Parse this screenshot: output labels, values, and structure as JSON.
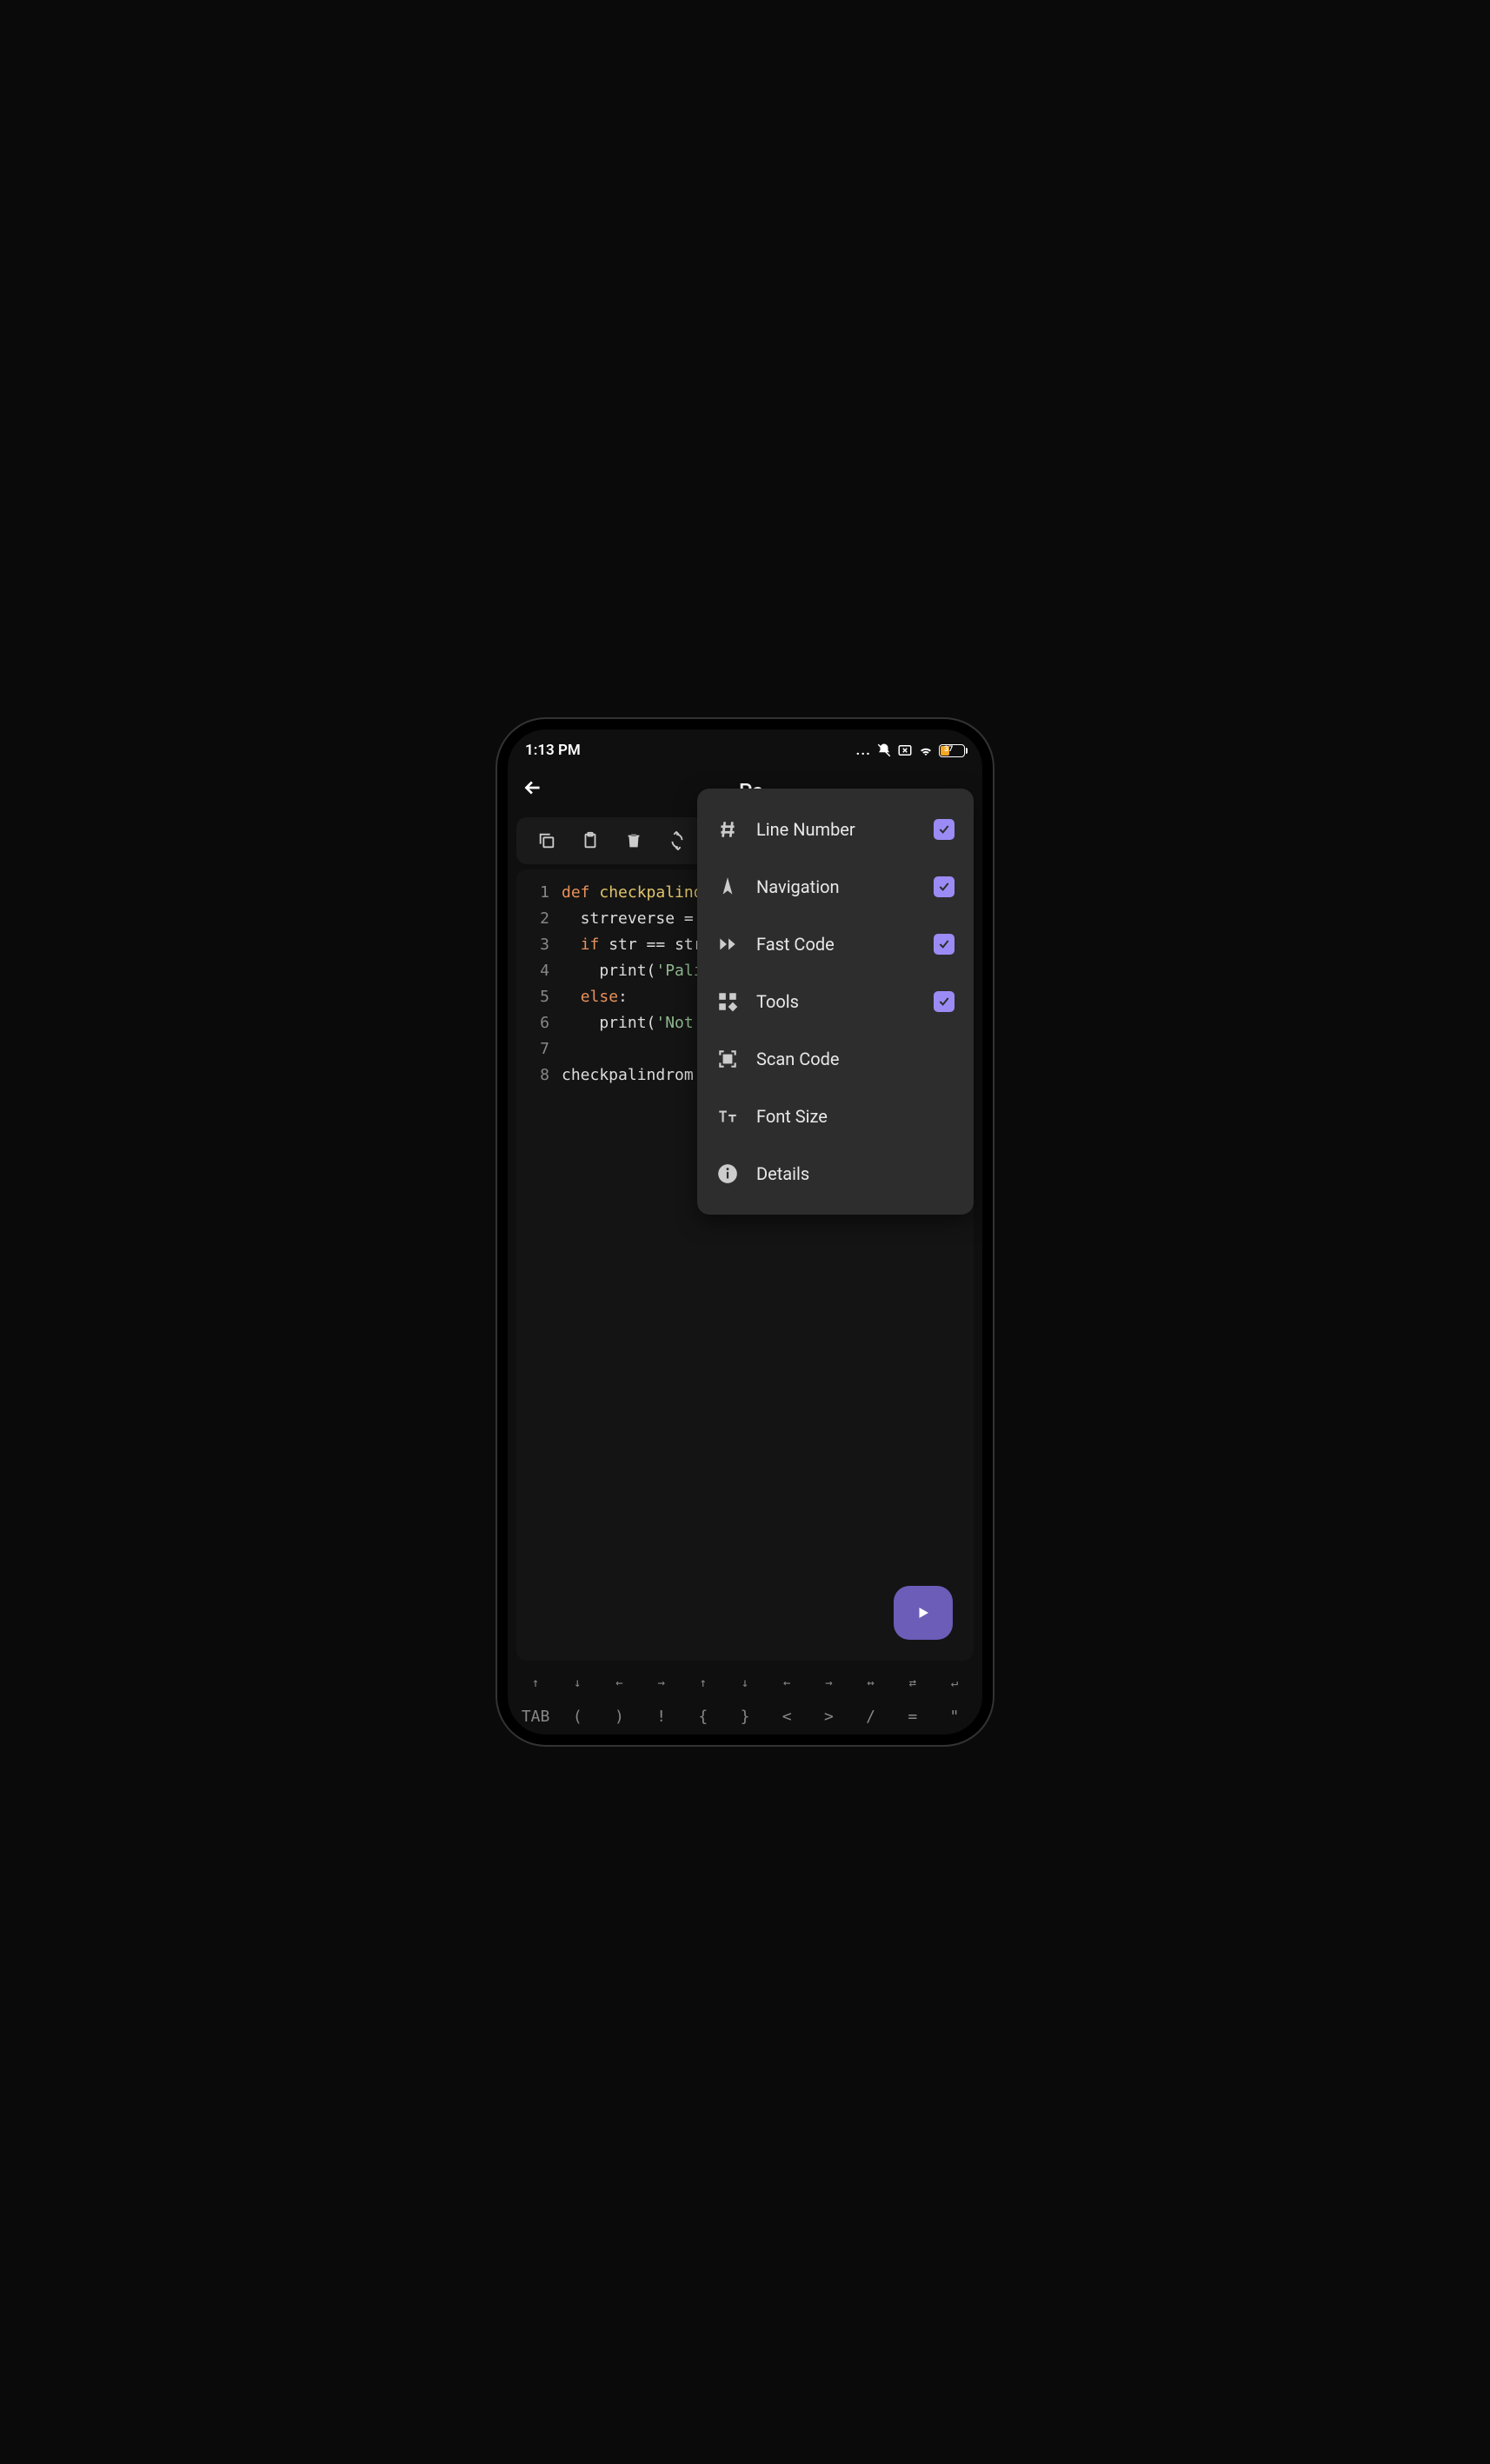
{
  "status": {
    "time": "1:13 PM",
    "battery_pct": "37"
  },
  "header": {
    "title": "Pa"
  },
  "code": {
    "lines": [
      {
        "num": "1",
        "tokens": [
          {
            "t": "def ",
            "c": "kw-def"
          },
          {
            "t": "checkpalind",
            "c": "fn-name"
          }
        ]
      },
      {
        "num": "2",
        "tokens": [
          {
            "t": "  strreverse = st",
            "c": "punct"
          }
        ]
      },
      {
        "num": "3",
        "tokens": [
          {
            "t": "  ",
            "c": "punct"
          },
          {
            "t": "if",
            "c": "kw-if"
          },
          {
            "t": " str == strreve",
            "c": "punct"
          }
        ]
      },
      {
        "num": "4",
        "tokens": [
          {
            "t": "    print(",
            "c": "punct"
          },
          {
            "t": "'Palindro",
            "c": "str"
          }
        ]
      },
      {
        "num": "5",
        "tokens": [
          {
            "t": "  ",
            "c": "punct"
          },
          {
            "t": "else",
            "c": "kw-else"
          },
          {
            "t": ":",
            "c": "punct"
          }
        ]
      },
      {
        "num": "6",
        "tokens": [
          {
            "t": "    print(",
            "c": "punct"
          },
          {
            "t": "'Not a pa",
            "c": "str"
          }
        ]
      },
      {
        "num": "7",
        "tokens": []
      },
      {
        "num": "8",
        "tokens": [
          {
            "t": "checkpalindrom",
            "c": "punct"
          }
        ]
      }
    ]
  },
  "popup": {
    "items": [
      {
        "icon": "hash",
        "label": "Line Number",
        "checked": true
      },
      {
        "icon": "nav",
        "label": "Navigation",
        "checked": true
      },
      {
        "icon": "fast",
        "label": "Fast Code",
        "checked": true
      },
      {
        "icon": "tools",
        "label": "Tools",
        "checked": true
      },
      {
        "icon": "scan",
        "label": "Scan Code",
        "checked": false
      },
      {
        "icon": "font",
        "label": "Font Size",
        "checked": false
      },
      {
        "icon": "info",
        "label": "Details",
        "checked": false
      }
    ]
  },
  "nav_arrows": [
    "↑",
    "↓",
    "←",
    "→",
    "↑",
    "↓",
    "←",
    "→",
    "↔",
    "⇄",
    "↵"
  ],
  "symbols": [
    "TAB",
    "(",
    ")",
    "!",
    "{",
    "}",
    "<",
    ">",
    "/",
    "=",
    "\""
  ]
}
